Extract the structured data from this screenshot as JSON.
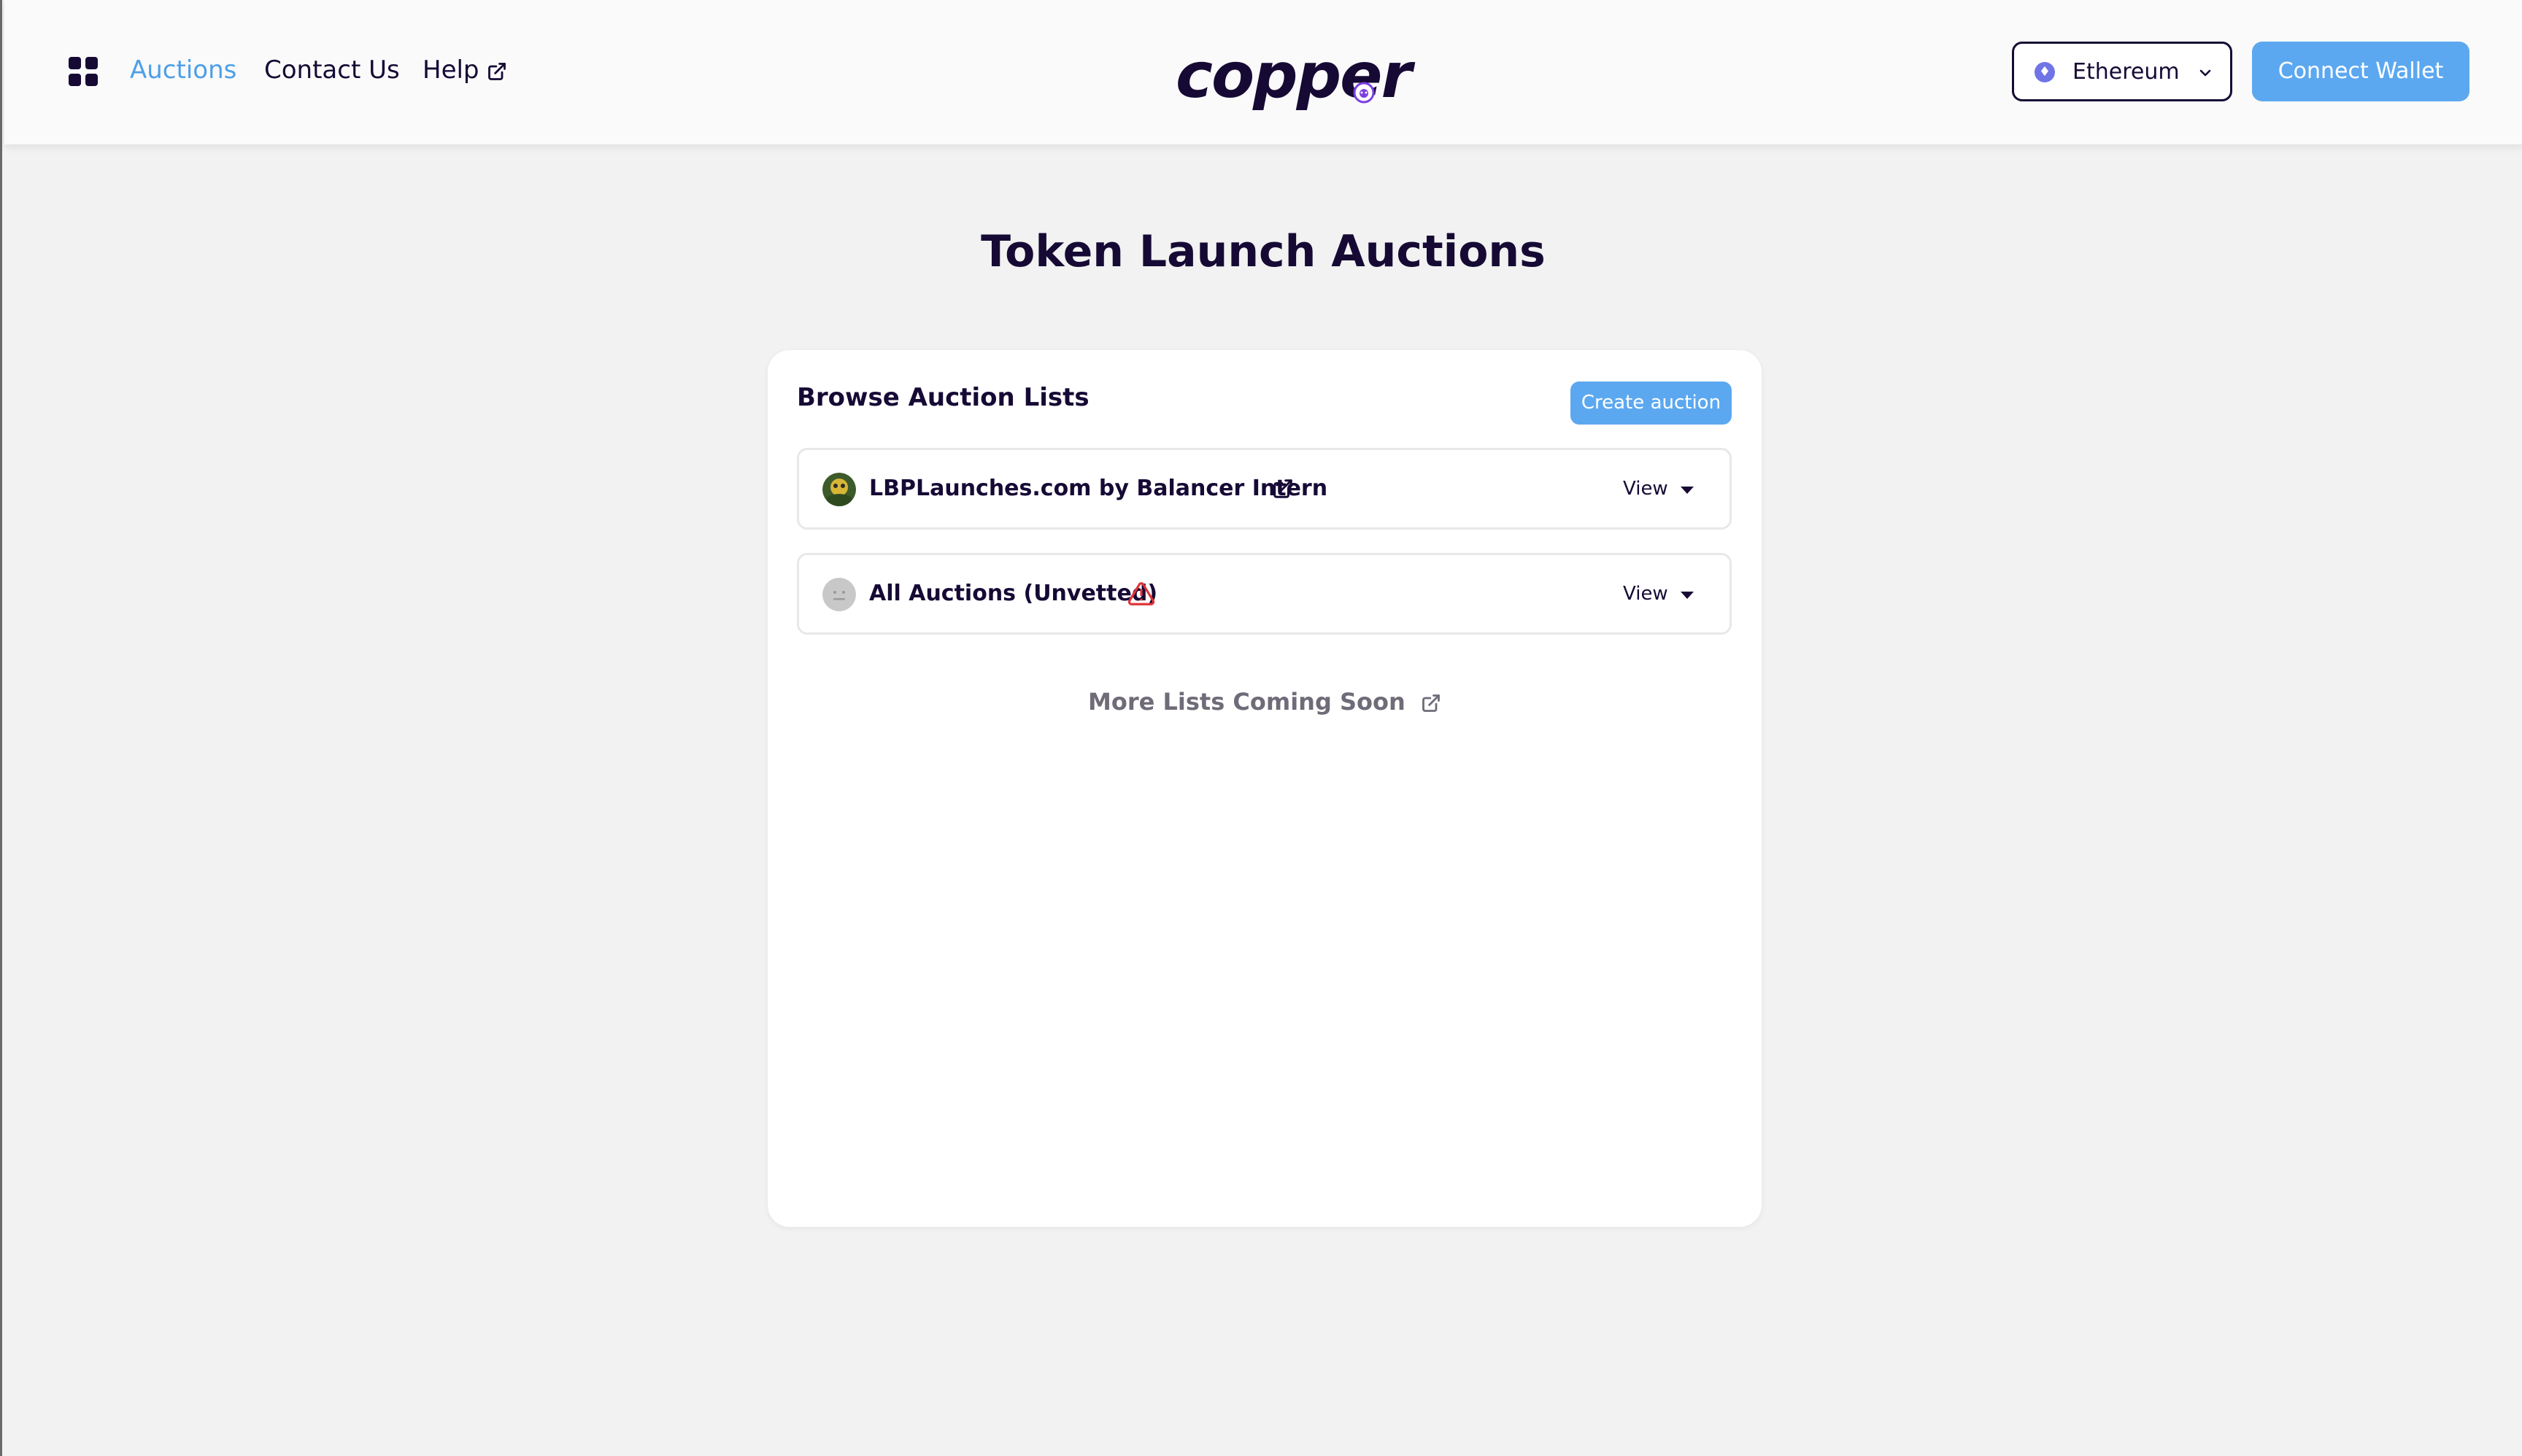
{
  "header": {
    "nav": {
      "auctions": "Auctions",
      "contact": "Contact Us",
      "help": "Help"
    },
    "logo_text": "copper",
    "network": {
      "selected": "Ethereum",
      "icon": "ethereum-icon"
    },
    "connect_wallet": "Connect Wallet"
  },
  "main": {
    "title": "Token Launch Auctions",
    "card": {
      "title": "Browse Auction Lists",
      "create_button": "Create auction",
      "lists": [
        {
          "label": "LBPLaunches.com by Balancer Intern",
          "action": "View",
          "icon": "external-link-icon"
        },
        {
          "label": "All Auctions (Unvetted)",
          "action": "View",
          "icon": "warning-icon"
        }
      ],
      "more_lists": "More Lists Coming Soon"
    }
  },
  "colors": {
    "accent": "#5ca8f0",
    "primary_text": "#160a35",
    "background": "#f1f2f1",
    "warning": "#e0333a"
  }
}
